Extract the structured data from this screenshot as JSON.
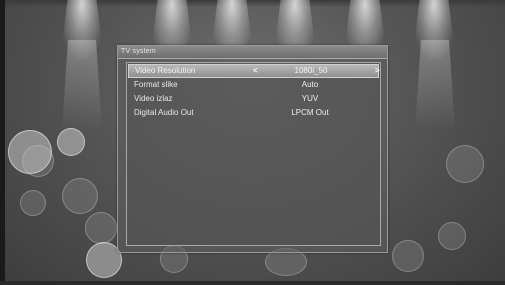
{
  "dialog": {
    "title": "TV system"
  },
  "settings": [
    {
      "label": "Video Resolution",
      "value": "1080i_50",
      "selected": true
    },
    {
      "label": "Format slike",
      "value": "Auto",
      "selected": false
    },
    {
      "label": "Video izlaz",
      "value": "YUV",
      "selected": false
    },
    {
      "label": "Digital Audio Out",
      "value": "LPCM Out",
      "selected": false
    }
  ],
  "icons": {
    "left": "chevron-left-icon",
    "right": "chevron-right-icon"
  },
  "arrows": {
    "left": "<",
    "right": ">"
  }
}
